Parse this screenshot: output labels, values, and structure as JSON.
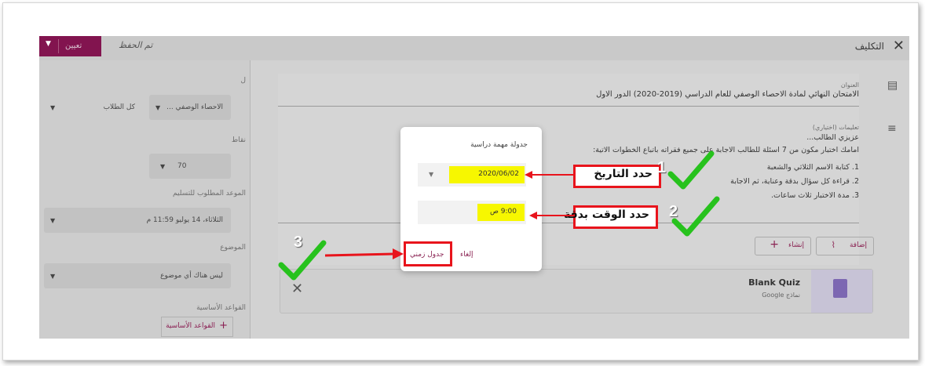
{
  "app": {
    "page_title": "التكليف",
    "assign_button": "تعيين",
    "saved_status": "تم الحفظ"
  },
  "left_panel": {
    "for_label": "ل",
    "class_select": "الاحصاء الوصفي ...",
    "students_select": "كل الطلاب",
    "points_label": "نقاط",
    "points_value": "70",
    "due_label": "الموعد المطلوب للتسليم",
    "due_value": "الثلاثاء، 14 يوليو 11:59 م",
    "topic_label": "الموضوع",
    "topic_value": "ليس هناك أي موضوع",
    "rubric_label": "القواعد الأساسية",
    "rubric_button": "القواعد الأساسية"
  },
  "main": {
    "title_label": "العنوان",
    "title_value": "الامتحان النهائي لمادة الاحصاء الوصفي للعام الدراسي (2019-2020) الدور الاول",
    "instructions_label": "تعليمات (اختياري)",
    "instructions_lines": [
      "عزيزي الطالب...",
      "امامك اختبار مكون من 7 اسئلة للطالب الاجابة على جميع فقراته باتباع الخطوات الاتية:",
      "1.   كتابة الاسم الثلاثي والشعبة",
      "2.   قراءة كل سؤال بدقة وعناية، ثم الاجابة",
      "3.   مدة الاختبار ثلاث ساعات."
    ],
    "add_button": "إضافة",
    "create_button": "إنشاء",
    "quiz_title": "Blank Quiz",
    "quiz_subtitle": "نماذج Google"
  },
  "dialog": {
    "title": "جدولة مهمة دراسية",
    "date_value": "2020/06/02",
    "time_value": "9:00 ص",
    "cancel": "إلغاء",
    "schedule": "جدول زمني"
  },
  "annotations": {
    "step1_number": "1",
    "step1_label": "حدد التاريخ",
    "step2_number": "2",
    "step2_label": "حدد الوقت بدقة",
    "step3_number": "3"
  },
  "colors": {
    "accent": "#82144f",
    "highlight": "#f7f700",
    "annotation_red": "#e8141c",
    "check_green": "#27c21d"
  },
  "icons": {
    "close": "close-icon",
    "assignment": "clipboard-icon",
    "menu": "lines-icon",
    "attach": "paperclip-icon",
    "plus": "plus-icon",
    "dropdown": "chevron-down-icon",
    "check": "check-mark-icon",
    "arrow": "arrow-icon"
  }
}
